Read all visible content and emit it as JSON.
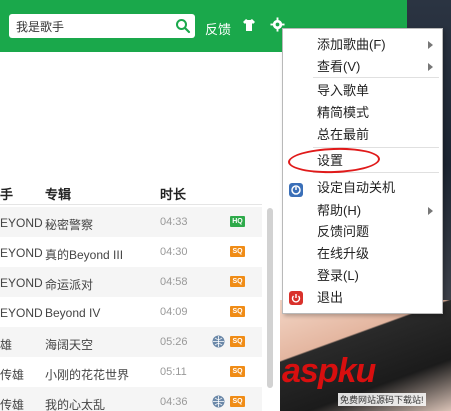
{
  "search": {
    "value": "我是歌手"
  },
  "topbar": {
    "feedback_label": "反馈"
  },
  "table": {
    "headers": {
      "singer": "手",
      "album": "专辑",
      "duration": "时长"
    },
    "rows": [
      {
        "singer": "EYOND",
        "album": "秘密警察",
        "duration": "04:33",
        "quality": "HQ",
        "globe": false
      },
      {
        "singer": "EYOND",
        "album": "真的Beyond III",
        "duration": "04:30",
        "quality": "SQ",
        "globe": false
      },
      {
        "singer": "EYOND",
        "album": "命运派对",
        "duration": "04:58",
        "quality": "SQ",
        "globe": false
      },
      {
        "singer": "EYOND",
        "album": "Beyond IV",
        "duration": "04:09",
        "quality": "SQ",
        "globe": false
      },
      {
        "singer": "雄",
        "album": "海阔天空",
        "duration": "05:26",
        "quality": "SQ",
        "globe": true
      },
      {
        "singer": "传雄",
        "album": "小刚的花花世界",
        "duration": "05:11",
        "quality": "SQ",
        "globe": false
      },
      {
        "singer": "传雄",
        "album": "我的心太乱",
        "duration": "04:36",
        "quality": "SQ",
        "globe": true
      }
    ]
  },
  "menu": {
    "items": [
      {
        "label": "添加歌曲(F)",
        "submenu": true
      },
      {
        "label": "查看(V)",
        "submenu": true
      },
      {
        "label": "导入歌单",
        "submenu": false
      },
      {
        "label": "精简模式",
        "submenu": false
      },
      {
        "label": "总在最前",
        "submenu": false
      },
      {
        "label": "设置",
        "submenu": false
      },
      {
        "label": "设定自动关机",
        "submenu": false
      },
      {
        "label": "帮助(H)",
        "submenu": true
      },
      {
        "label": "反馈问题",
        "submenu": false
      },
      {
        "label": "在线升级",
        "submenu": false
      },
      {
        "label": "登录(L)",
        "submenu": false
      },
      {
        "label": "退出",
        "submenu": false
      }
    ]
  },
  "watermark": {
    "main": "aspku",
    "sub": "免费网站源码下载站!"
  },
  "colors": {
    "brand_green": "#1aa84b",
    "hq_green": "#2eaa4a",
    "sq_orange": "#f08c16",
    "annotation_red": "#e01a1a"
  }
}
